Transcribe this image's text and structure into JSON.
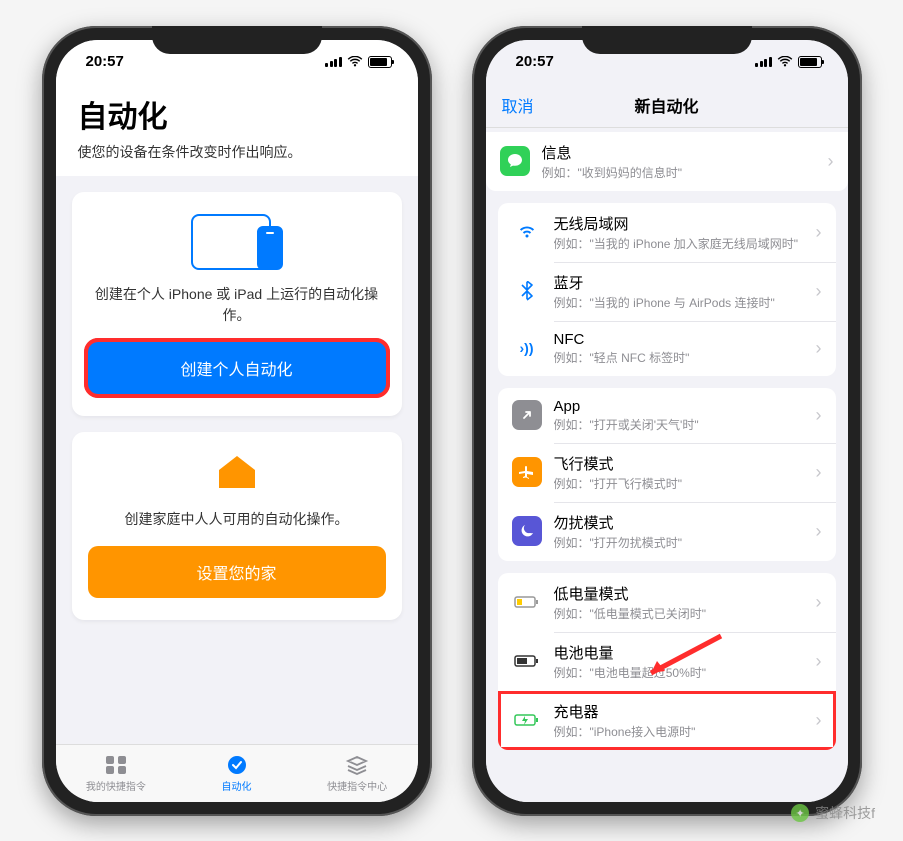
{
  "status": {
    "time": "20:57"
  },
  "left": {
    "header_title": "自动化",
    "header_sub": "使您的设备在条件改变时作出响应。",
    "card1_sub": "创建在个人 iPhone 或 iPad 上运行的自动化操作。",
    "card1_btn": "创建个人自动化",
    "card2_sub": "创建家庭中人人可用的自动化操作。",
    "card2_btn": "设置您的家",
    "tabs": [
      {
        "label": "我的快捷指令"
      },
      {
        "label": "自动化"
      },
      {
        "label": "快捷指令中心"
      }
    ]
  },
  "right": {
    "cancel": "取消",
    "title": "新自动化",
    "groups": [
      {
        "rows": [
          {
            "icon": "message",
            "title": "信息",
            "sub": "例如：\"收到妈妈的信息时\""
          }
        ]
      },
      {
        "rows": [
          {
            "icon": "wifi",
            "title": "无线局域网",
            "sub": "例如：\"当我的 iPhone 加入家庭无线局域网时\""
          },
          {
            "icon": "bluetooth",
            "title": "蓝牙",
            "sub": "例如：\"当我的 iPhone 与 AirPods 连接时\""
          },
          {
            "icon": "nfc",
            "title": "NFC",
            "sub": "例如：\"轻点 NFC 标签时\""
          }
        ]
      },
      {
        "rows": [
          {
            "icon": "app",
            "title": "App",
            "sub": "例如：\"打开或关闭'天气'时\""
          },
          {
            "icon": "airplane",
            "title": "飞行模式",
            "sub": "例如：\"打开飞行模式时\""
          },
          {
            "icon": "dnd",
            "title": "勿扰模式",
            "sub": "例如：\"打开勿扰模式时\""
          }
        ]
      },
      {
        "rows": [
          {
            "icon": "lowpower",
            "title": "低电量模式",
            "sub": "例如：\"低电量模式已关闭时\""
          },
          {
            "icon": "battery",
            "title": "电池电量",
            "sub": "例如：\"电池电量超过50%时\""
          },
          {
            "icon": "charger",
            "title": "充电器",
            "sub": "例如：\"iPhone接入电源时\""
          }
        ]
      }
    ]
  },
  "watermark": "蜜蜂科技f"
}
